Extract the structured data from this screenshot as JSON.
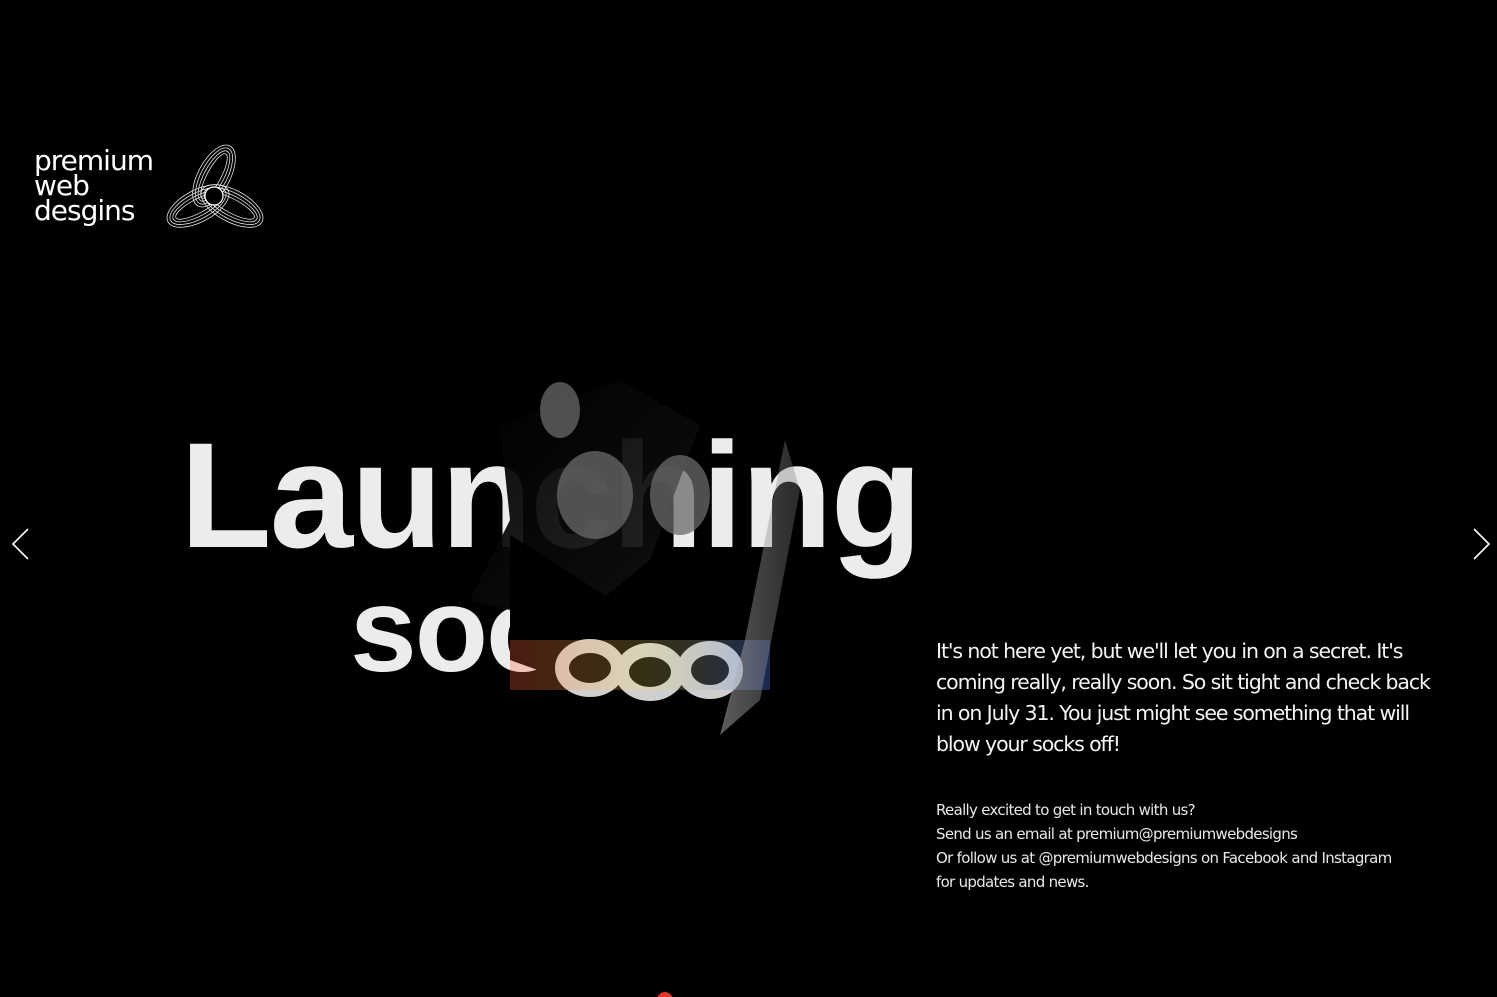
{
  "brand": {
    "logo_lines": [
      "premium",
      "web",
      "desgins"
    ],
    "logo_icon": "interlocking-rings-icon"
  },
  "hero": {
    "line1": "Launching",
    "line2": "soon"
  },
  "carousel": {
    "prev_icon": "chevron-left-icon",
    "next_icon": "chevron-right-icon"
  },
  "copy": {
    "lead": "It's not here yet, but we'll let you in on a secret. It's coming really, really soon. So sit tight and check back in on July 31. You just might see something that will blow your socks off!",
    "contact": [
      "Really excited to get in touch with us?",
      "Send us an email at premium@premiumwebdesigns",
      "Or follow us at @premiumwebdesigns on Facebook and Instagram",
      "for updates and news."
    ]
  },
  "colors": {
    "background": "#000000",
    "text": "#f2f2f2",
    "accent_dot": "#e0382a"
  }
}
